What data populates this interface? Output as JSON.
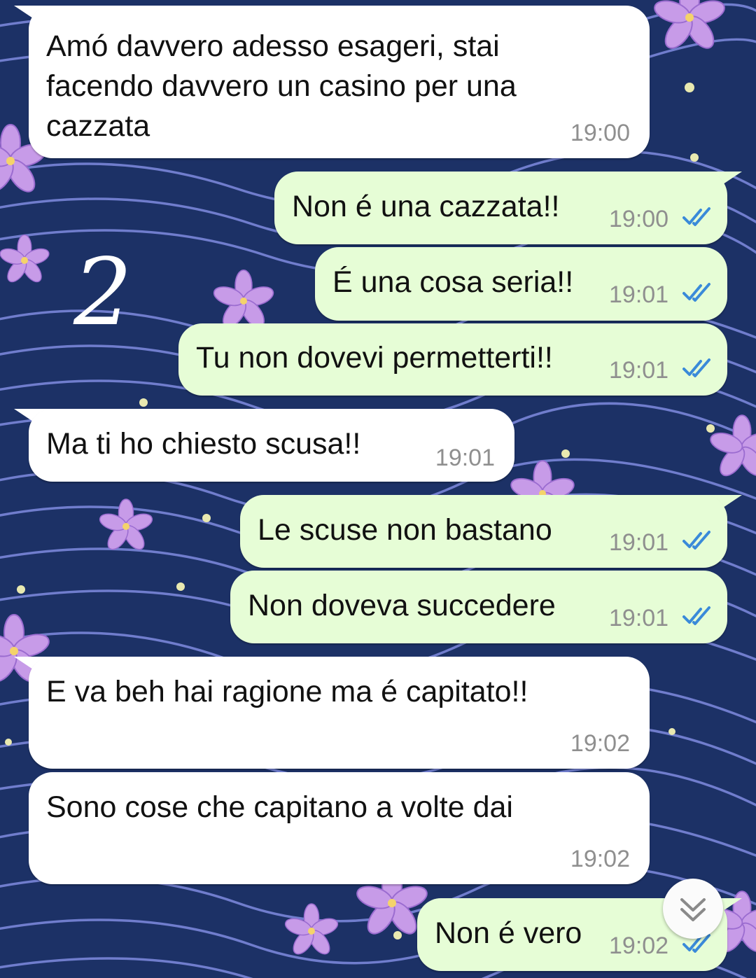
{
  "stamp_number": "2",
  "colors": {
    "incoming_bubble": "#ffffff",
    "outgoing_bubble": "#e6fdd6",
    "read_ticks": "#3a8ad9",
    "wallpaper": "#1c3166"
  },
  "messages": [
    {
      "direction": "incoming",
      "text": "Amó davvero adesso esageri, stai\nfacendo davvero un casino per una\ncazzata",
      "time": "19:00"
    },
    {
      "direction": "outgoing",
      "text": "Non é una cazzata!!",
      "time": "19:00",
      "status": "read-double-check-icon"
    },
    {
      "direction": "outgoing",
      "text": "É una cosa seria!!",
      "time": "19:01",
      "status": "read-double-check-icon"
    },
    {
      "direction": "outgoing",
      "text": "Tu non dovevi permetterti!!",
      "time": "19:01",
      "status": "read-double-check-icon"
    },
    {
      "direction": "incoming",
      "text": "Ma ti ho chiesto scusa!!",
      "time": "19:01"
    },
    {
      "direction": "outgoing",
      "text": "Le scuse non bastano",
      "time": "19:01",
      "status": "read-double-check-icon"
    },
    {
      "direction": "outgoing",
      "text": "Non doveva succedere",
      "time": "19:01",
      "status": "read-double-check-icon"
    },
    {
      "direction": "incoming",
      "text": "E va beh hai ragione ma é capitato!!",
      "time": "19:02"
    },
    {
      "direction": "incoming",
      "text": "Sono cose che capitano a volte dai",
      "time": "19:02"
    },
    {
      "direction": "outgoing",
      "text": "Non é vero",
      "time": "19:02",
      "status": "read-double-check-icon"
    }
  ],
  "scroll_button": {
    "icon": "double-chevron-down-icon"
  }
}
